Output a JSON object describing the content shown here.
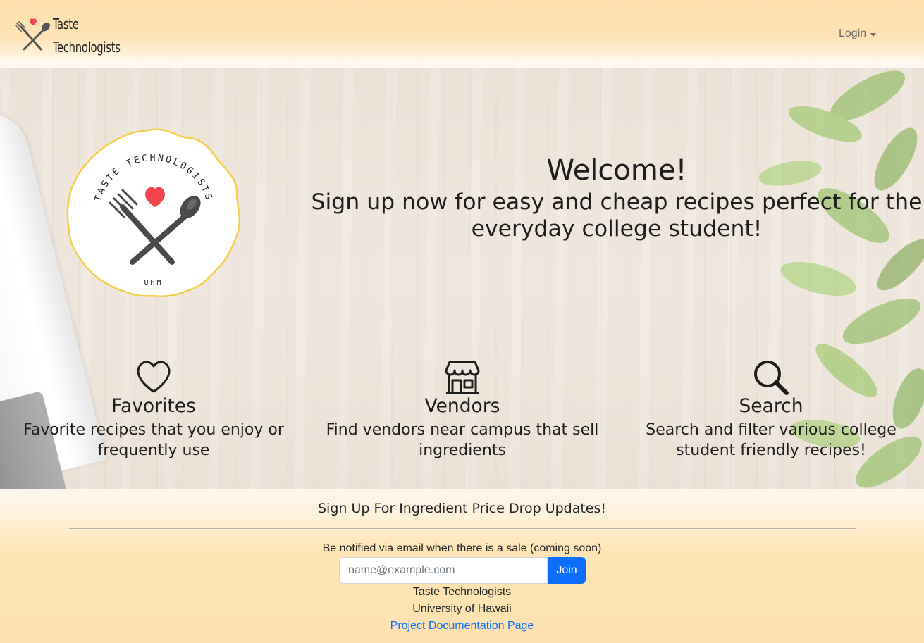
{
  "navbar": {
    "brand_line1": "Taste",
    "brand_line2": "Technologists",
    "login_label": "Login"
  },
  "hero": {
    "logo_top_text": "TASTE TECHNOLOGISTS",
    "logo_bottom_text": "UHM",
    "welcome_title": "Welcome!",
    "welcome_subtitle": "Sign up now for easy and cheap recipes perfect for the everyday college student!",
    "features": [
      {
        "icon": "heart-icon",
        "title": "Favorites",
        "description": "Favorite recipes that you enjoy or frequently use"
      },
      {
        "icon": "shop-icon",
        "title": "Vendors",
        "description": "Find vendors near campus that sell ingredients"
      },
      {
        "icon": "search-icon",
        "title": "Search",
        "description": "Search and filter various college student friendly recipes!"
      }
    ]
  },
  "footer": {
    "signup_title": "Sign Up For Ingredient Price Drop Updates!",
    "notify_text": "Be notified via email when there is a sale (coming soon)",
    "email_placeholder": "name@example.com",
    "join_label": "Join",
    "org_name": "Taste Technologists",
    "university": "University of Hawaii",
    "docs_link": "Project Documentation Page"
  },
  "colors": {
    "accent": "#0d6efd",
    "heart": "#f0454b",
    "banner": "#ffe2b0",
    "badge_border": "#f5cf4a"
  }
}
